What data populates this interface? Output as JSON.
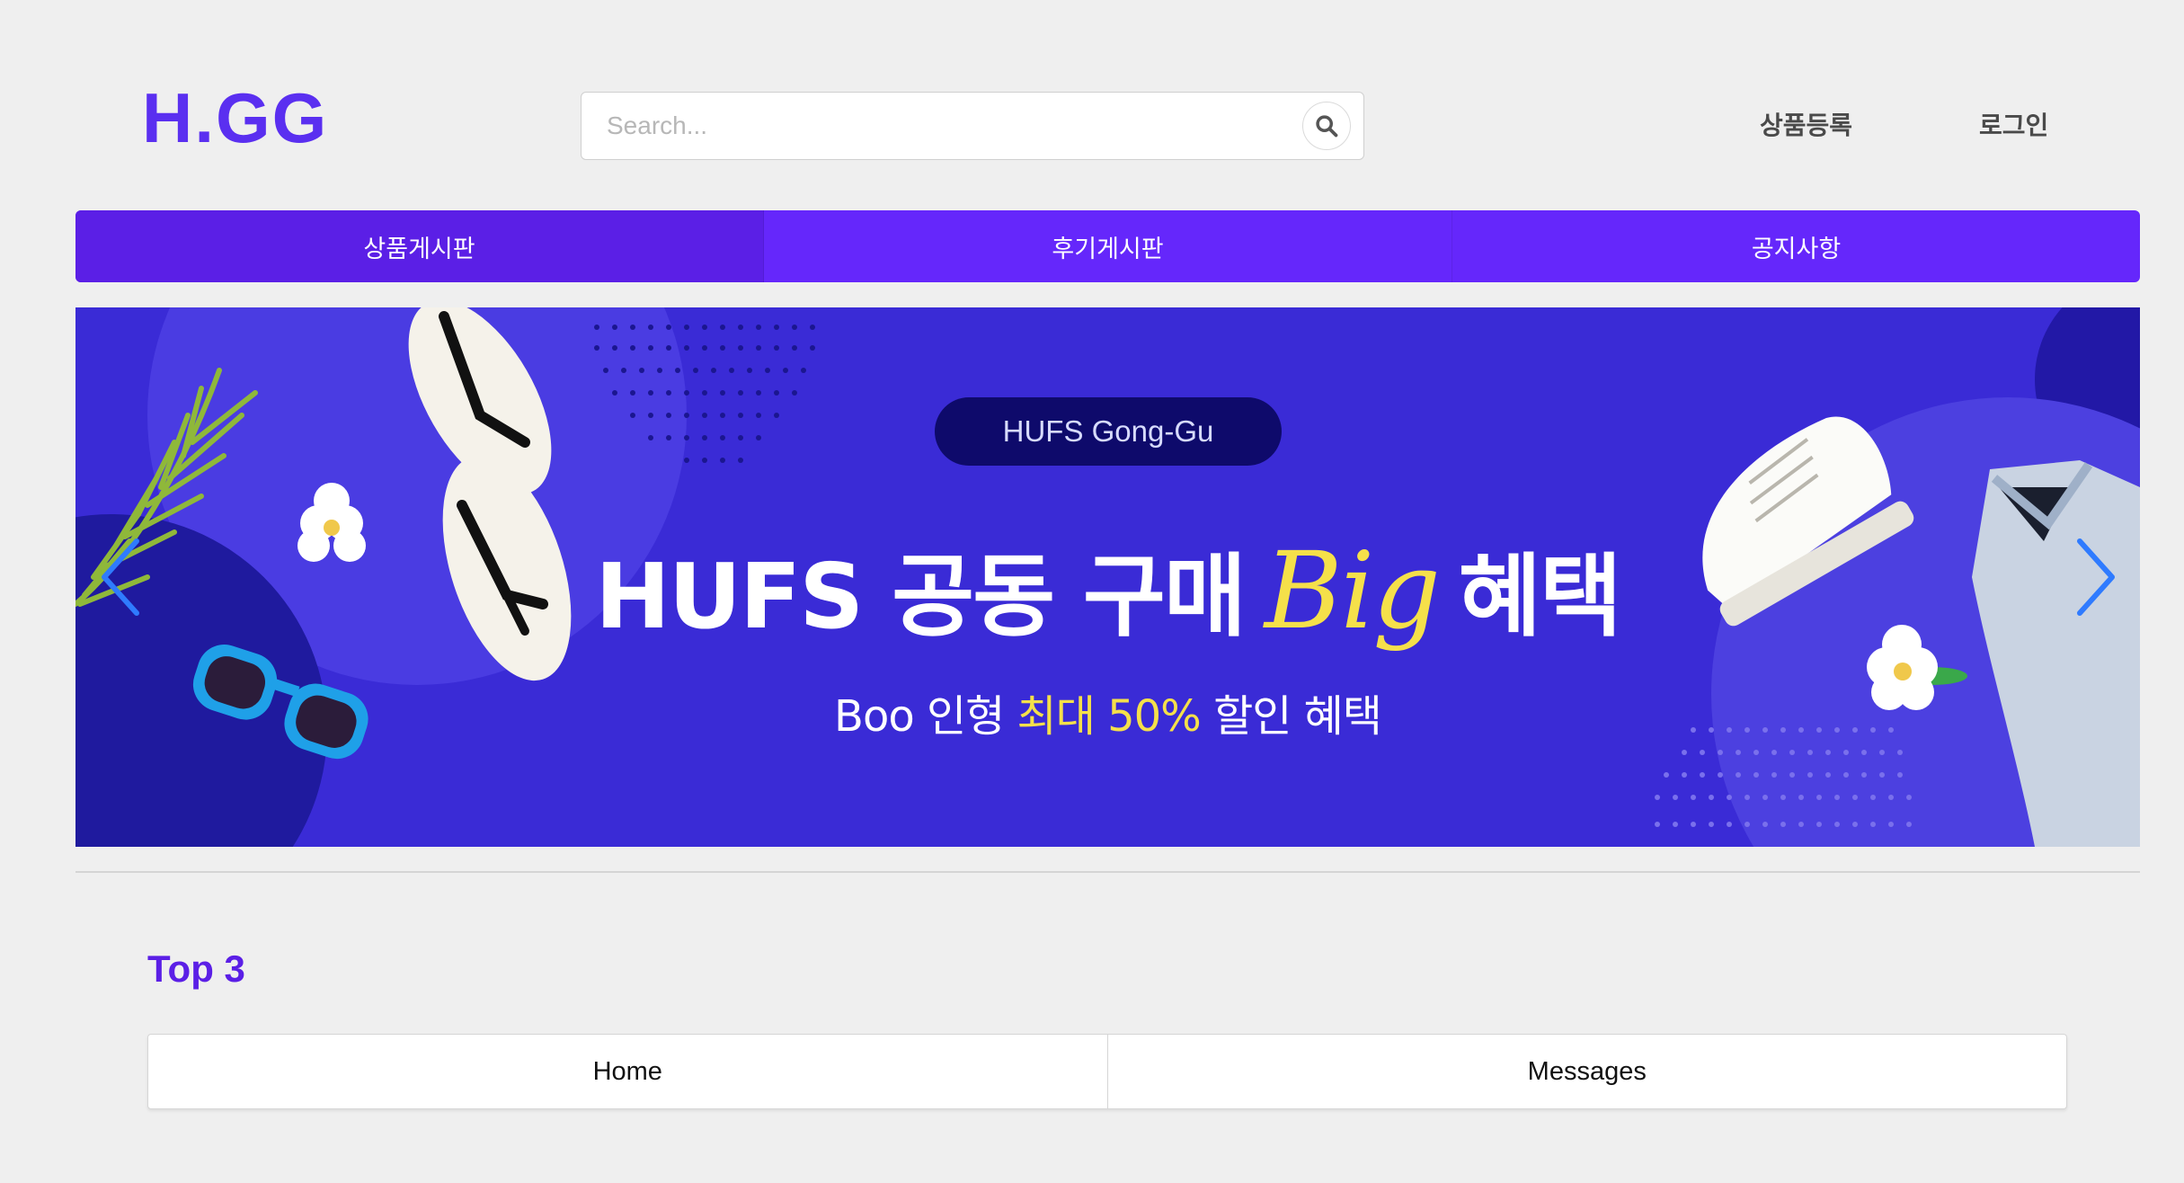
{
  "header": {
    "logo": "H.GG",
    "search": {
      "placeholder": "Search..."
    },
    "links": {
      "register": "상품등록",
      "login": "로그인"
    }
  },
  "nav": {
    "tabs": [
      {
        "label": "상품게시판"
      },
      {
        "label": "후기게시판"
      },
      {
        "label": "공지사항"
      }
    ]
  },
  "banner": {
    "pill": "HUFS Gong-Gu",
    "headline_main": "HUFS 공동 구매",
    "headline_accent": "Big",
    "headline_end": "혜택",
    "sub_start": "Boo 인형",
    "sub_highlight": "최대 50%",
    "sub_end": "할인 혜택"
  },
  "section": {
    "title": "Top 3",
    "tabs": [
      {
        "label": "Home"
      },
      {
        "label": "Messages"
      }
    ]
  },
  "colors": {
    "brand": "#6527fb",
    "banner_bg": "#3a2bd6",
    "highlight": "#f5e04a"
  }
}
